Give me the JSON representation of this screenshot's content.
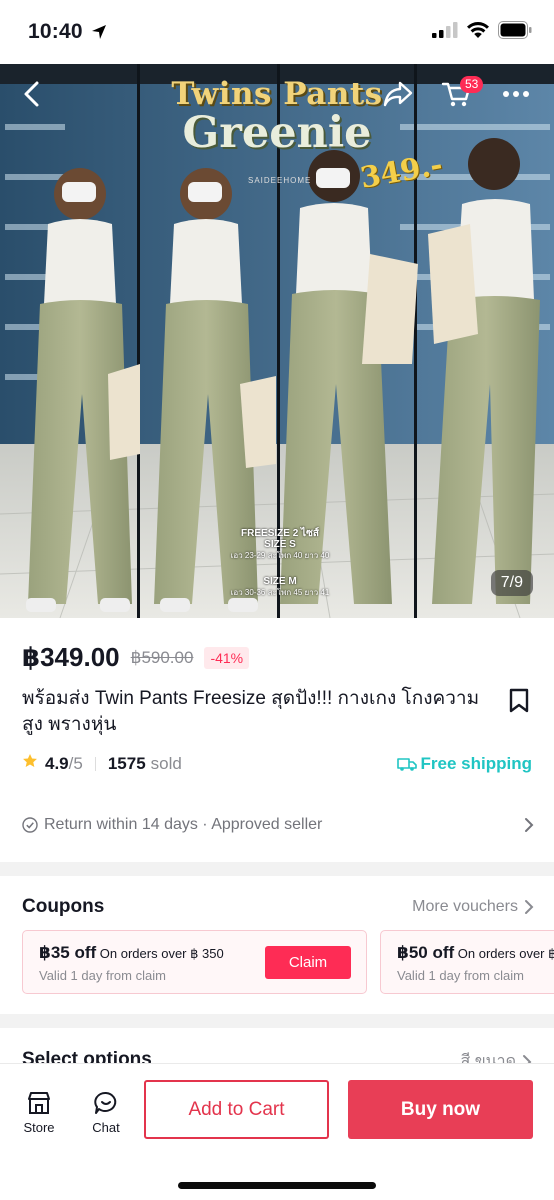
{
  "status_bar": {
    "time": "10:40"
  },
  "hero": {
    "title_line1": "Twins Pants",
    "title_line2": "Greenie",
    "price_tag": "349.-",
    "brand": "SAIDEEHOME",
    "size_s_heading": "FREESIZE 2 ไซส์",
    "size_s_label": "SIZE S",
    "size_s_detail": "เอว 23-29 สะโพก 40 ยาว 40",
    "size_m_label": "SIZE M",
    "size_m_detail": "เอว 30-36 สะโพก 45 ยาว 41",
    "image_counter": "7/9",
    "cart_count": "53"
  },
  "product": {
    "price": "฿349.00",
    "original_price": "฿590.00",
    "discount": "-41%",
    "title": "พร้อมส่ง Twin Pants Freesize สุดปัง!!! กางเกง โกงความสูง พรางหุ่น",
    "rating": "4.9",
    "rating_out_of": "/5",
    "sold_count": "1575",
    "sold_label": "sold",
    "free_shipping": "Free shipping",
    "return_policy": "Return within 14 days · Approved seller"
  },
  "coupons": {
    "title": "Coupons",
    "more_label": "More vouchers",
    "items": [
      {
        "amount": "฿35 off",
        "condition": "On orders over ฿ 350",
        "validity": "Valid 1 day from claim",
        "button": "Claim"
      },
      {
        "amount": "฿50 off",
        "condition": "On orders over ฿",
        "validity": "Valid 1 day from claim",
        "button": ""
      }
    ]
  },
  "select_options": {
    "label": "Select options",
    "value": "สี ขนาด"
  },
  "bottom_bar": {
    "store_label": "Store",
    "chat_label": "Chat",
    "add_to_cart": "Add to Cart",
    "buy_now": "Buy now"
  },
  "colors": {
    "accent": "#fe2c55",
    "teal": "#20c5c3",
    "buy_button": "#e83e56"
  }
}
